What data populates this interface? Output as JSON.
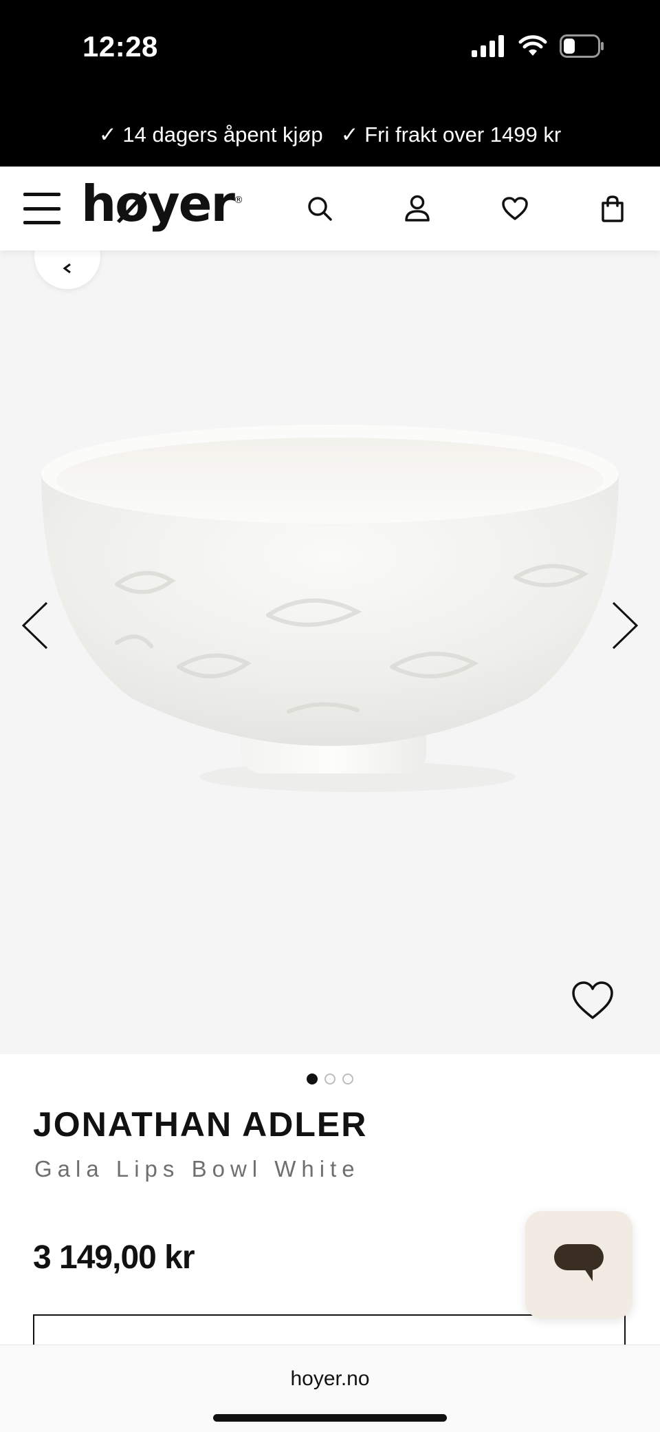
{
  "status_bar": {
    "time": "12:28"
  },
  "promo": {
    "item1": "✓ 14 dagers åpent kjøp",
    "item2": "✓ Fri frakt over 1499 kr"
  },
  "header": {
    "logo": "høyer",
    "logo_mark": "®",
    "icons": [
      "menu-icon",
      "search-icon",
      "account-icon",
      "heart-icon",
      "bag-icon"
    ]
  },
  "gallery": {
    "image_count": 3,
    "active_index": 0,
    "icons": [
      "chevron-left-icon",
      "chevron-right-icon",
      "heart-icon"
    ]
  },
  "product": {
    "brand": "JONATHAN ADLER",
    "name": "Gala Lips Bowl White",
    "price": "3 149,00 kr"
  },
  "browser": {
    "url": "hoyer.no"
  },
  "colors": {
    "black": "#000000",
    "gallery_bg": "#f5f5f5",
    "chat_bg": "#f1ebe3",
    "chat_icon": "#3a2e22"
  }
}
